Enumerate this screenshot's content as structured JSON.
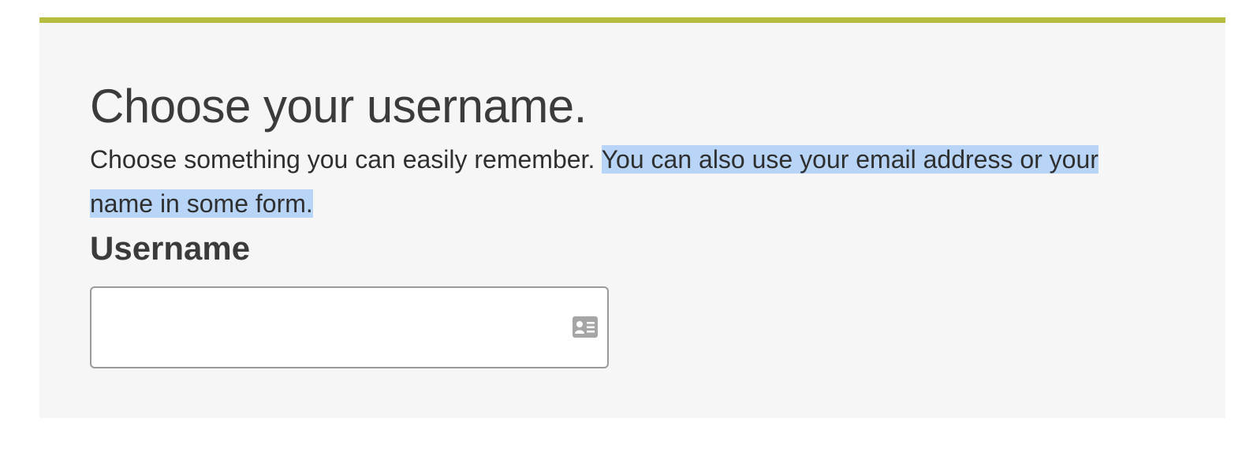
{
  "page": {
    "heading": "Choose your username.",
    "description_plain": "Choose something you can easily remember. ",
    "description_selected": "You can also use your email address or your name in some form.",
    "field_label": "Username",
    "field_value": "",
    "field_icon": "contact-card-icon"
  },
  "colors": {
    "accent_bar": "#b5bc3f",
    "card_background": "#f6f6f6",
    "selection_highlight": "#b8d5f7"
  }
}
